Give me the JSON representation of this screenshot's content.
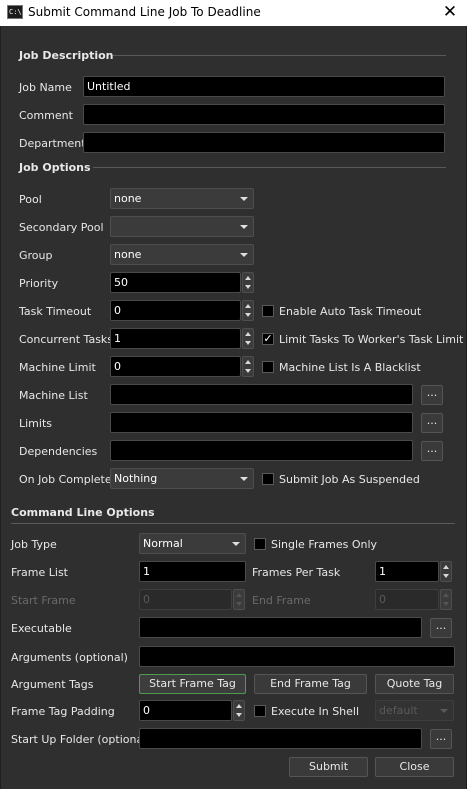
{
  "window": {
    "title": "Submit Command Line Job To Deadline",
    "app_icon_text": "C:\\"
  },
  "job_description": {
    "header": "Job Description",
    "job_name_label": "Job Name",
    "job_name_value": "Untitled",
    "comment_label": "Comment",
    "comment_value": "",
    "department_label": "Department",
    "department_value": ""
  },
  "job_options": {
    "header": "Job Options",
    "pool_label": "Pool",
    "pool_value": "none",
    "secondary_pool_label": "Secondary Pool",
    "secondary_pool_value": "",
    "group_label": "Group",
    "group_value": "none",
    "priority_label": "Priority",
    "priority_value": "50",
    "task_timeout_label": "Task Timeout",
    "task_timeout_value": "0",
    "enable_auto_timeout_label": "Enable Auto Task Timeout",
    "enable_auto_timeout_checked": false,
    "concurrent_tasks_label": "Concurrent Tasks",
    "concurrent_tasks_value": "1",
    "limit_tasks_label": "Limit Tasks To Worker's Task Limit",
    "limit_tasks_checked": true,
    "machine_limit_label": "Machine Limit",
    "machine_limit_value": "0",
    "blacklist_label": "Machine List Is A Blacklist",
    "blacklist_checked": false,
    "machine_list_label": "Machine List",
    "machine_list_value": "",
    "limits_label": "Limits",
    "limits_value": "",
    "dependencies_label": "Dependencies",
    "dependencies_value": "",
    "browse_label": "...",
    "on_job_complete_label": "On Job Complete",
    "on_job_complete_value": "Nothing",
    "submit_suspended_label": "Submit Job As Suspended",
    "submit_suspended_checked": false
  },
  "command_line_options": {
    "header": "Command Line Options",
    "job_type_label": "Job Type",
    "job_type_value": "Normal",
    "single_frames_label": "Single Frames Only",
    "single_frames_checked": false,
    "frame_list_label": "Frame List",
    "frame_list_value": "1",
    "frames_per_task_label": "Frames Per Task",
    "frames_per_task_value": "1",
    "start_frame_label": "Start Frame",
    "start_frame_value": "0",
    "end_frame_label": "End Frame",
    "end_frame_value": "0",
    "executable_label": "Executable",
    "executable_value": "",
    "arguments_label": "Arguments (optional)",
    "arguments_value": "",
    "argument_tags_label": "Argument Tags",
    "start_frame_tag_label": "Start Frame Tag",
    "end_frame_tag_label": "End Frame Tag",
    "quote_tag_label": "Quote Tag",
    "frame_tag_padding_label": "Frame Tag Padding",
    "frame_tag_padding_value": "0",
    "execute_in_shell_label": "Execute In Shell",
    "execute_in_shell_checked": false,
    "shell_value": "default",
    "startup_folder_label": "Start Up Folder (optional)",
    "startup_folder_value": "",
    "browse_label": "..."
  },
  "footer": {
    "submit_label": "Submit",
    "close_label": "Close"
  },
  "colors": {
    "background": "#2f2f2f",
    "field": "#000000",
    "highlight_border": "#4e9a4e"
  }
}
